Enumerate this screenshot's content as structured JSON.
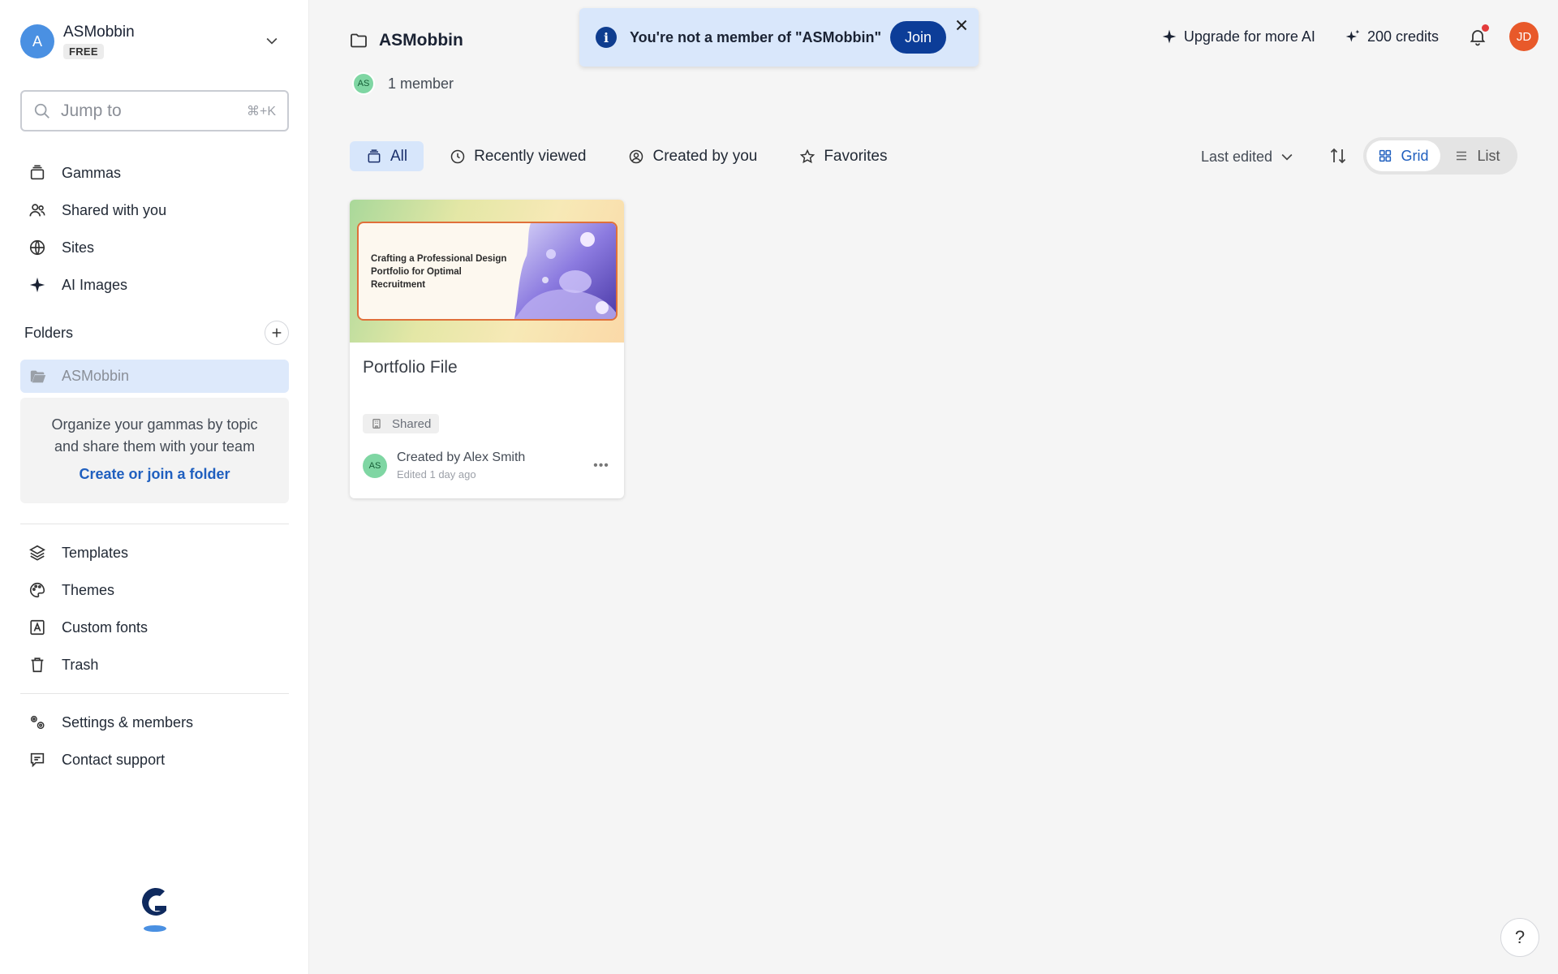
{
  "workspace": {
    "initial": "A",
    "name": "ASMobbin",
    "plan": "FREE"
  },
  "search": {
    "placeholder": "Jump to",
    "shortcut": "⌘+K"
  },
  "nav_primary": [
    {
      "label": "Gammas",
      "icon": "stack-icon"
    },
    {
      "label": "Shared with you",
      "icon": "users-icon"
    },
    {
      "label": "Sites",
      "icon": "globe-icon"
    },
    {
      "label": "AI Images",
      "icon": "sparkle-icon"
    }
  ],
  "folders": {
    "title": "Folders",
    "selected": "ASMobbin",
    "hint": "Organize your gammas by topic and share them with your team",
    "link": "Create or join a folder"
  },
  "nav_secondary": [
    {
      "label": "Templates",
      "icon": "layers-icon"
    },
    {
      "label": "Themes",
      "icon": "palette-icon"
    },
    {
      "label": "Custom fonts",
      "icon": "font-icon"
    },
    {
      "label": "Trash",
      "icon": "trash-icon"
    }
  ],
  "nav_tertiary": [
    {
      "label": "Settings & members",
      "icon": "settings-icon"
    },
    {
      "label": "Contact support",
      "icon": "chat-icon"
    }
  ],
  "header": {
    "title": "ASMobbin",
    "member_initials": "AS",
    "members": "1 member"
  },
  "banner": {
    "text": "You're not a member of \"ASMobbin\"",
    "join": "Join"
  },
  "topbar": {
    "upgrade": "Upgrade for more AI",
    "credits": "200 credits",
    "user_initials": "JD"
  },
  "filters": [
    {
      "label": "All",
      "active": true
    },
    {
      "label": "Recently viewed",
      "active": false
    },
    {
      "label": "Created by you",
      "active": false
    },
    {
      "label": "Favorites",
      "active": false
    }
  ],
  "sort": {
    "label": "Last edited"
  },
  "view": {
    "grid": "Grid",
    "list": "List",
    "active": "Grid"
  },
  "cards": [
    {
      "slide_title": "Crafting a Professional Design Portfolio for Optimal Recruitment",
      "title": "Portfolio File",
      "badge": "Shared",
      "author_initials": "AS",
      "created_by": "Created by Alex Smith",
      "edited": "Edited 1 day ago"
    }
  ],
  "help": "?",
  "colors": {
    "accent": "#1f5fbf",
    "banner_bg": "#d9e7fb",
    "join_bg": "#0c3d98",
    "user_avatar": "#e8592a"
  }
}
